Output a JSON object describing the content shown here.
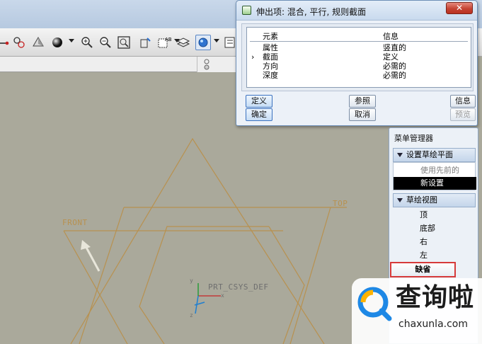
{
  "dialog": {
    "title": "伸出项: 混合, 平行, 规则截面",
    "close_glyph": "✕",
    "columns": [
      "元素",
      "信息"
    ],
    "rows": [
      {
        "element": "属性",
        "info": "竖直的",
        "marker": ""
      },
      {
        "element": "截面",
        "info": "定义",
        "marker": "›"
      },
      {
        "element": "方向",
        "info": "必需的",
        "marker": ""
      },
      {
        "element": "深度",
        "info": "必需的",
        "marker": ""
      }
    ],
    "buttons": {
      "define": "定义",
      "reference": "参照",
      "info": "信息",
      "ok": "确定",
      "cancel": "取消",
      "preview": "预览"
    }
  },
  "menu_manager": {
    "title": "菜单管理器",
    "section1": {
      "header": "设置草绘平面",
      "items": [
        "使用先前的",
        "新设置"
      ]
    },
    "section2": {
      "header": "草绘视图",
      "items": [
        "顶",
        "底部",
        "右",
        "左"
      ]
    },
    "default_button": "缺省"
  },
  "viewport": {
    "labels": {
      "front": "FRONT",
      "top": "TOP",
      "csys": "PRT_CSYS_DEF",
      "axis_x": "x",
      "axis_y": "y",
      "axis_z": "z"
    }
  },
  "watermark": {
    "chinese": "查询啦",
    "url": "chaxunla.com"
  },
  "icons": [
    "sketch-icon",
    "blend-icon",
    "render-sphere-icon",
    "zoom-in-icon",
    "zoom-out-icon",
    "refit-icon",
    "orient-icon",
    "view-manager-icon",
    "layer-icon",
    "display-style-icon",
    "datum-icon"
  ],
  "colors": {
    "dialog_border": "#6d8fb7",
    "datum_lines": "#b8914f",
    "highlight_box": "#d63a3a",
    "selected_item": "#000000"
  }
}
